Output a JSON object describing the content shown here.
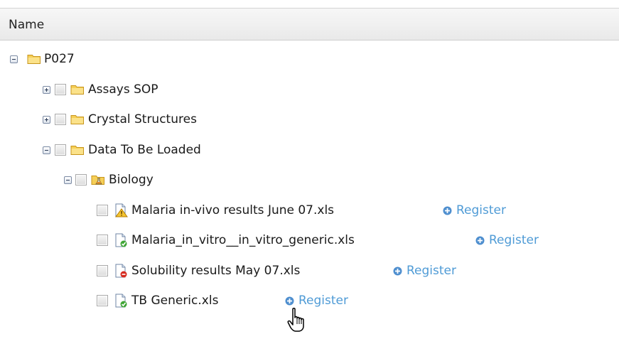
{
  "column_header": {
    "name_label": "Name"
  },
  "tree": {
    "root": {
      "label": "P027",
      "expanded": true,
      "icon": "folder-icon"
    },
    "folders": [
      {
        "label": "Assays SOP",
        "expanded": false,
        "icon": "folder-icon"
      },
      {
        "label": "Crystal Structures",
        "expanded": false,
        "icon": "folder-icon"
      },
      {
        "label": "Data To Be Loaded",
        "expanded": true,
        "icon": "folder-icon"
      }
    ],
    "subfolder": {
      "label": "Biology",
      "expanded": true,
      "icon": "biology-folder-icon"
    },
    "files": [
      {
        "label": "Malaria in-vivo results June 07.xls",
        "status_icon": "warning-file-icon",
        "action": "Register"
      },
      {
        "label": "Malaria_in_vitro__in_vitro_generic.xls",
        "status_icon": "ok-file-icon",
        "action": "Register"
      },
      {
        "label": "Solubility results May 07.xls",
        "status_icon": "error-file-icon",
        "action": "Register"
      },
      {
        "label": "TB Generic.xls",
        "status_icon": "ok-file-icon",
        "action": "Register"
      }
    ]
  },
  "colors": {
    "link": "#4f9bd6",
    "folder": "#f6cf57",
    "header_bg": "#eeeeee"
  }
}
